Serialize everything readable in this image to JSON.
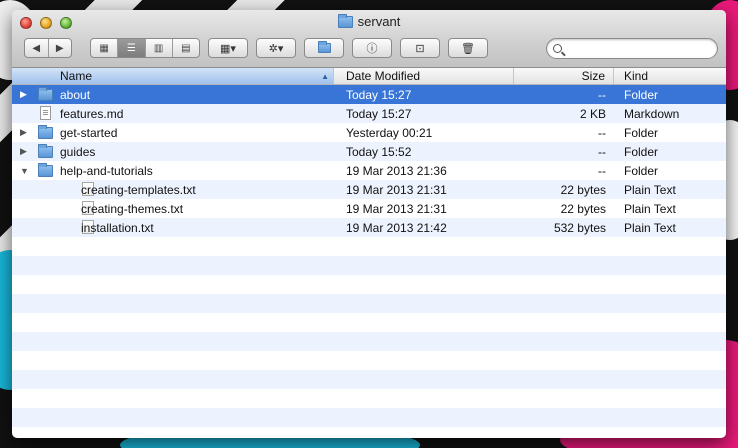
{
  "window": {
    "title": "servant"
  },
  "toolbar": {
    "back": "◀",
    "forward": "▶",
    "view_icon": "▦",
    "view_list": "☰",
    "view_columns": "▥",
    "view_coverflow": "▤",
    "arrange": "▦▾",
    "action": "✲▾",
    "new_folder": "+",
    "get_info": "ⓘ",
    "connect": "⊡",
    "delete": "🗑",
    "search_placeholder": ""
  },
  "columns": {
    "name": "Name",
    "date": "Date Modified",
    "size": "Size",
    "kind": "Kind"
  },
  "rows": [
    {
      "name": "about",
      "date": "Today 15:27",
      "size": "--",
      "kind": "Folder",
      "type": "folder",
      "depth": 0,
      "disclosure": "▶",
      "selected": true
    },
    {
      "name": "features.md",
      "date": "Today 15:27",
      "size": "2 KB",
      "kind": "Markdown",
      "type": "doc",
      "depth": 0,
      "disclosure": ""
    },
    {
      "name": "get-started",
      "date": "Yesterday 00:21",
      "size": "--",
      "kind": "Folder",
      "type": "folder",
      "depth": 0,
      "disclosure": "▶"
    },
    {
      "name": "guides",
      "date": "Today 15:52",
      "size": "--",
      "kind": "Folder",
      "type": "folder",
      "depth": 0,
      "disclosure": "▶"
    },
    {
      "name": "help-and-tutorials",
      "date": "19 Mar 2013 21:36",
      "size": "--",
      "kind": "Folder",
      "type": "folder",
      "depth": 0,
      "disclosure": "▼"
    },
    {
      "name": "creating-templates.txt",
      "date": "19 Mar 2013 21:31",
      "size": "22 bytes",
      "kind": "Plain Text",
      "type": "txt",
      "depth": 1,
      "disclosure": ""
    },
    {
      "name": "creating-themes.txt",
      "date": "19 Mar 2013 21:31",
      "size": "22 bytes",
      "kind": "Plain Text",
      "type": "txt",
      "depth": 1,
      "disclosure": ""
    },
    {
      "name": "installation.txt",
      "date": "19 Mar 2013 21:42",
      "size": "532 bytes",
      "kind": "Plain Text",
      "type": "txt",
      "depth": 1,
      "disclosure": ""
    }
  ],
  "colors": {
    "selection": "#3875d7",
    "stripe": "#edf3fe",
    "header_sorted": "#9fc1eb"
  }
}
